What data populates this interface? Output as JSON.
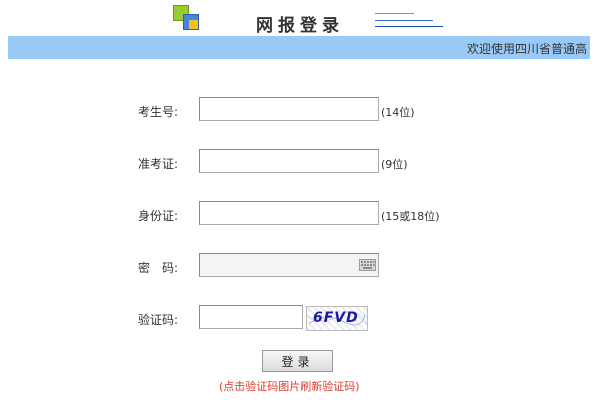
{
  "header": {
    "title": "网报登录"
  },
  "banner": {
    "marquee_text": "欢迎使用四川省普通高"
  },
  "form": {
    "candidate_no_label": "考生号:",
    "candidate_no_hint": "(14位)",
    "ticket_no_label": "准考证:",
    "ticket_no_hint": "(9位)",
    "id_card_label": "身份证:",
    "id_card_hint": "(15或18位)",
    "password_label": "密　码:",
    "captcha_label": "验证码:",
    "captcha_text": "6FVD",
    "login_label": "登录",
    "refresh_hint": "(点击验证码图片刷新验证码)"
  },
  "icons": {
    "logo": "logo-icon",
    "keyboard": "keyboard-icon"
  },
  "colors": {
    "banner_bg": "#99c9f7",
    "hint_red": "#e03a2a",
    "captcha_blue": "#1a1aa8"
  }
}
